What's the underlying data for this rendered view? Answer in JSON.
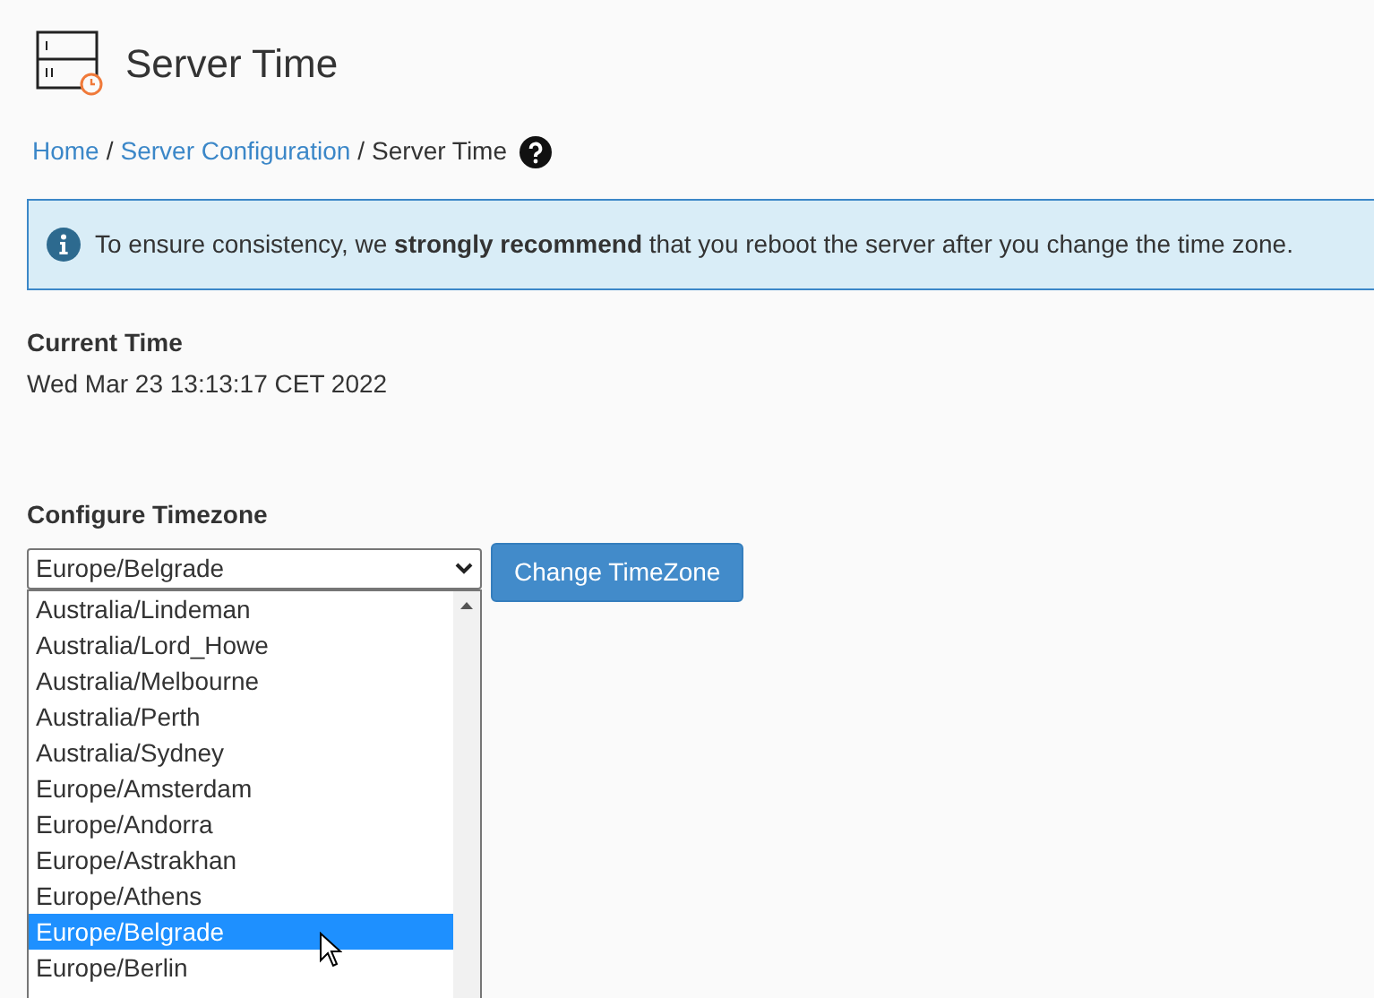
{
  "page": {
    "title": "Server Time"
  },
  "breadcrumb": [
    {
      "label": "Home",
      "kind": "link"
    },
    {
      "label": "/",
      "kind": "separator"
    },
    {
      "label": "Server Configuration",
      "kind": "link"
    },
    {
      "label": "/",
      "kind": "separator"
    },
    {
      "label": "Server Time",
      "kind": "current"
    }
  ],
  "notice": {
    "text": "To ensure consistency, we **strongly recommend** that you reboot the server after you change the time zone."
  },
  "current_time": {
    "label": "Current Time",
    "value": "Wed Mar 23 13:13:17 CET 2022"
  },
  "timezone": {
    "label": "Configure Timezone",
    "value": "Europe/Belgrade",
    "button": "Change TimeZone",
    "options": [
      {
        "label": "Australia/Lindeman",
        "selected": false
      },
      {
        "label": "Australia/Lord_Howe",
        "selected": false
      },
      {
        "label": "Australia/Melbourne",
        "selected": false
      },
      {
        "label": "Australia/Perth",
        "selected": false
      },
      {
        "label": "Australia/Sydney",
        "selected": false
      },
      {
        "label": "Europe/Amsterdam",
        "selected": false
      },
      {
        "label": "Europe/Andorra",
        "selected": false
      },
      {
        "label": "Europe/Astrakhan",
        "selected": false
      },
      {
        "label": "Europe/Athens",
        "selected": false
      },
      {
        "label": "Europe/Belgrade",
        "selected": true
      },
      {
        "label": "Europe/Berlin",
        "selected": false
      }
    ]
  }
}
